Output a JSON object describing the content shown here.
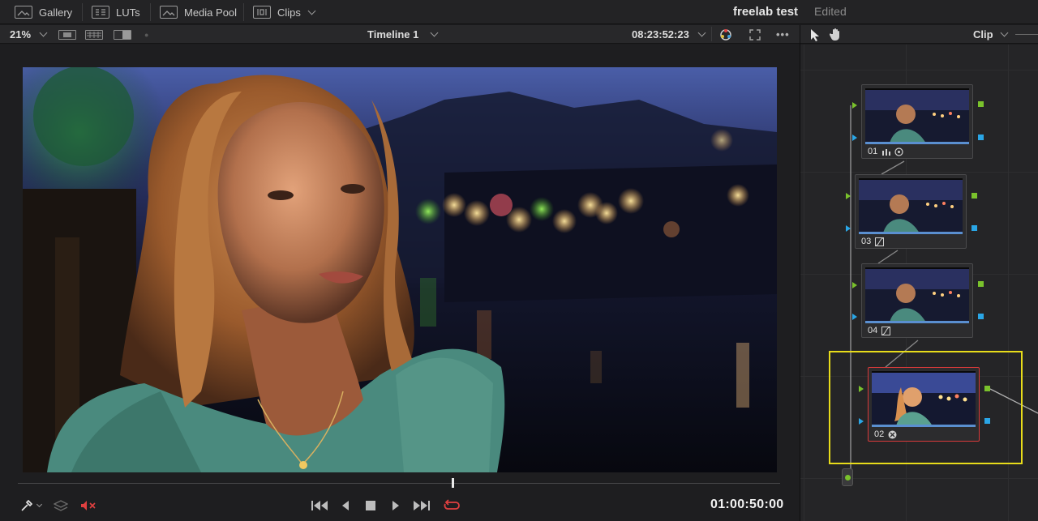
{
  "topbar": {
    "gallery_label": "Gallery",
    "luts_label": "LUTs",
    "media_pool_label": "Media Pool",
    "clips_label": "Clips",
    "project_title": "freelab test",
    "project_status": "Edited"
  },
  "viewerbar": {
    "zoom": "21%",
    "timeline_name": "Timeline 1",
    "source_timecode": "08:23:52:23"
  },
  "nodebar": {
    "mode_label": "Clip"
  },
  "transport": {
    "timecode": "01:00:50:00",
    "playhead_position": 0.57
  },
  "nodes": [
    {
      "number": "01",
      "icons": [
        "bars-icon",
        "circle-dot-icon"
      ]
    },
    {
      "number": "03",
      "icons": [
        "curve-icon"
      ]
    },
    {
      "number": "04",
      "icons": [
        "curve-icon"
      ]
    },
    {
      "number": "02",
      "icons": [
        "no-effect-icon"
      ],
      "selected": true
    }
  ],
  "colors": {
    "accent_green": "#7ac22c",
    "accent_blue": "#2aa6e6",
    "selection_yellow": "#e8dc1a",
    "selected_node_red": "#d83a3a",
    "mute_red": "#e04040"
  }
}
